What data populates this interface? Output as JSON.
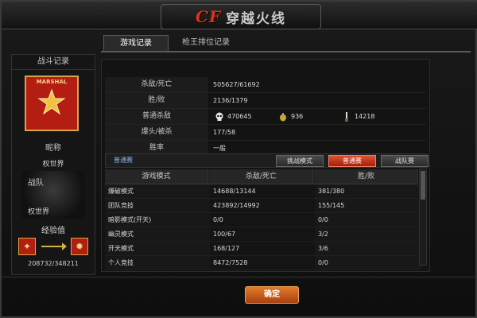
{
  "header": {
    "logo_cf": "CF",
    "logo_text": "穿越火线"
  },
  "tabs": [
    {
      "label": "游戏记录",
      "active": true
    },
    {
      "label": "枪王排位记录",
      "active": false
    }
  ],
  "left_panel": {
    "title": "战斗记录",
    "rank_label": "MARSHAL",
    "honor_label": "昵称",
    "honor_value": "权世界",
    "clan_label": "战队",
    "clan_value": "权世界",
    "exp_label": "经验值",
    "exp_value": "208732/348211"
  },
  "stats": {
    "rows": [
      {
        "label": "杀敌/死亡",
        "value": "505627/61692"
      },
      {
        "label": "胜/败",
        "value": "2136/1379"
      },
      {
        "label": "普通杀敌",
        "kills": [
          {
            "icon": "skull-icon",
            "value": "470645"
          },
          {
            "icon": "grenade-icon",
            "value": "936"
          },
          {
            "icon": "knife-icon",
            "value": "14218"
          }
        ]
      },
      {
        "label": "爆头/被杀",
        "value": "177/58"
      },
      {
        "label": "胜率",
        "value": "一般"
      }
    ]
  },
  "mode_bar": {
    "label": "普通赛",
    "buttons": [
      {
        "label": "挑战模式",
        "active": false
      },
      {
        "label": "普通赛",
        "active": true
      },
      {
        "label": "战队赛",
        "active": false
      }
    ]
  },
  "mode_table": {
    "headers": [
      "游戏模式",
      "杀敌/死亡",
      "胜/败"
    ],
    "rows": [
      [
        "爆破模式",
        "14688/13144",
        "381/380"
      ],
      [
        "团队竞技",
        "423892/14992",
        "155/145"
      ],
      [
        "暗影模式(开天)",
        "0/0",
        "0/0"
      ],
      [
        "幽灵模式",
        "100/67",
        "3/2"
      ],
      [
        "开天模式",
        "168/127",
        "3/6"
      ],
      [
        "个人竞技",
        "8472/7528",
        "0/0"
      ]
    ]
  },
  "footer": {
    "confirm_label": "确定"
  },
  "colors": {
    "accent": "#b31d12",
    "gold": "#d8a64a",
    "button_orange": "#e27a2a"
  }
}
